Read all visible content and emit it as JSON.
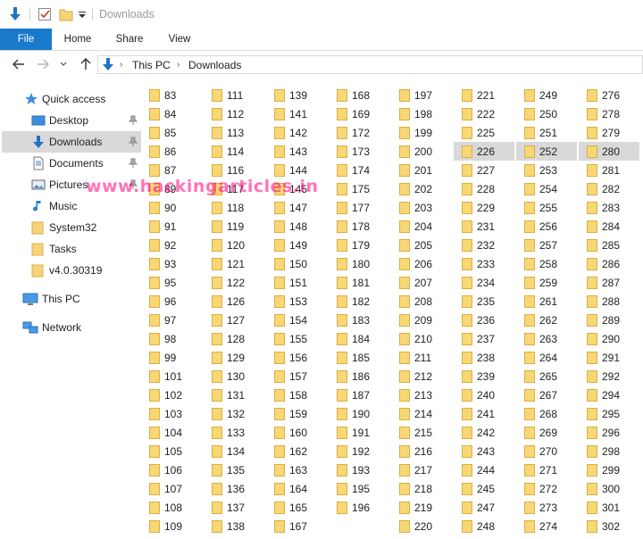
{
  "window": {
    "title": "Downloads"
  },
  "ribbon": {
    "tabs": [
      "File",
      "Home",
      "Share",
      "View"
    ]
  },
  "address": {
    "crumbs": [
      "This PC",
      "Downloads"
    ]
  },
  "nav": {
    "items": [
      {
        "label": "Quick access",
        "icon": "star-icon",
        "pinned": false
      },
      {
        "label": "Desktop",
        "icon": "desktop-icon",
        "pinned": true
      },
      {
        "label": "Downloads",
        "icon": "download-arrow-icon",
        "pinned": true
      },
      {
        "label": "Documents",
        "icon": "document-icon",
        "pinned": true
      },
      {
        "label": "Pictures",
        "icon": "pictures-icon",
        "pinned": true
      },
      {
        "label": "Music",
        "icon": "music-note-icon",
        "pinned": false
      },
      {
        "label": "System32",
        "icon": "folder-icon",
        "pinned": false
      },
      {
        "label": "Tasks",
        "icon": "folder-icon",
        "pinned": false
      },
      {
        "label": "v4.0.30319",
        "icon": "folder-icon",
        "pinned": false
      },
      {
        "label": "This PC",
        "icon": "computer-icon",
        "pinned": false
      },
      {
        "label": "Network",
        "icon": "network-icon",
        "pinned": false
      }
    ]
  },
  "folders": {
    "columns": [
      [
        "83",
        "84",
        "85",
        "86",
        "87",
        "89",
        "90",
        "91",
        "92",
        "93",
        "95",
        "96",
        "97",
        "98",
        "99",
        "101",
        "102",
        "103",
        "104",
        "105",
        "106",
        "107",
        "108",
        "109"
      ],
      [
        "111",
        "112",
        "113",
        "114",
        "116",
        "117",
        "118",
        "119",
        "120",
        "121",
        "122",
        "126",
        "127",
        "128",
        "129",
        "130",
        "131",
        "132",
        "133",
        "134",
        "135",
        "136",
        "137",
        "138"
      ],
      [
        "139",
        "141",
        "142",
        "143",
        "144",
        "145",
        "147",
        "148",
        "149",
        "150",
        "151",
        "153",
        "154",
        "155",
        "156",
        "157",
        "158",
        "159",
        "160",
        "162",
        "163",
        "164",
        "165",
        "167"
      ],
      [
        "168",
        "169",
        "172",
        "173",
        "174",
        "175",
        "177",
        "178",
        "179",
        "180",
        "181",
        "182",
        "183",
        "184",
        "185",
        "186",
        "187",
        "190",
        "191",
        "192",
        "193",
        "195",
        "196"
      ],
      [
        "197",
        "198",
        "199",
        "200",
        "201",
        "202",
        "203",
        "204",
        "205",
        "206",
        "207",
        "208",
        "209",
        "210",
        "211",
        "212",
        "213",
        "214",
        "215",
        "216",
        "217",
        "218",
        "219",
        "220"
      ],
      [
        "221",
        "222",
        "225",
        "226",
        "227",
        "228",
        "229",
        "231",
        "232",
        "233",
        "234",
        "235",
        "236",
        "237",
        "238",
        "239",
        "240",
        "241",
        "242",
        "243",
        "244",
        "245",
        "247",
        "248"
      ],
      [
        "249",
        "250",
        "251",
        "252",
        "253",
        "254",
        "255",
        "256",
        "257",
        "258",
        "259",
        "261",
        "262",
        "263",
        "264",
        "265",
        "267",
        "268",
        "269",
        "270",
        "271",
        "272",
        "273",
        "274"
      ],
      [
        "276",
        "278",
        "279",
        "280",
        "281",
        "282",
        "283",
        "284",
        "285",
        "286",
        "287",
        "288",
        "289",
        "290",
        "291",
        "292",
        "294",
        "295",
        "296",
        "298",
        "299",
        "300",
        "301",
        "302"
      ]
    ],
    "selected": [
      "226",
      "252",
      "280"
    ]
  },
  "watermark": "www.hackingarticles.in"
}
